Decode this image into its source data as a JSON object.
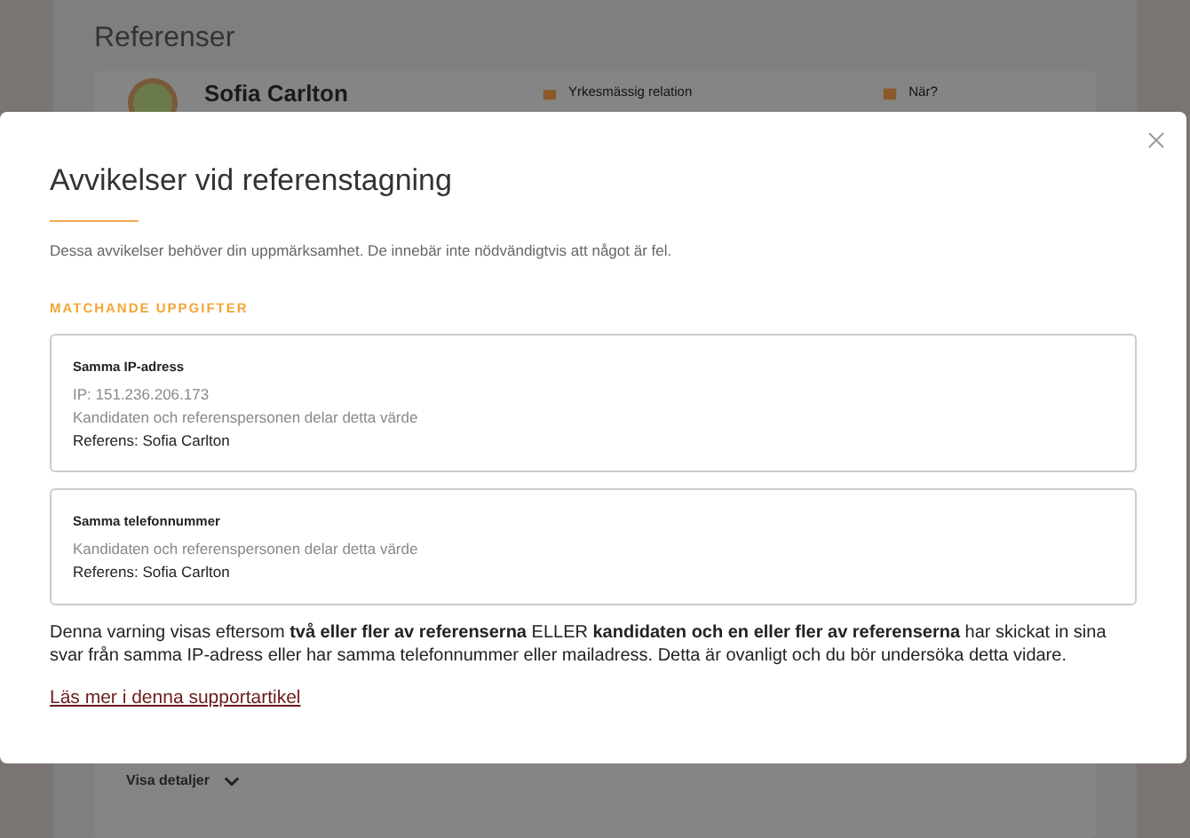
{
  "page": {
    "title": "Referenser",
    "reference": {
      "name": "Sofia Carlton",
      "relation_label": "Yrkesmässig relation",
      "when_label": "När?",
      "details_toggle": "Visa detaljer"
    }
  },
  "modal": {
    "title": "Avvikelser vid referenstagning",
    "description": "Dessa avvikelser behöver din uppmärksamhet. De innebär inte nödvändigtvis att något är fel.",
    "section_heading": "MATCHANDE UPPGIFTER",
    "matches": [
      {
        "title": "Samma IP-adress",
        "value": "IP: 151.236.206.173",
        "note": "Kandidaten och referenspersonen delar detta värde",
        "reference": "Referens: Sofia Carlton"
      },
      {
        "title": "Samma telefonnummer",
        "note": "Kandidaten och referenspersonen delar detta värde",
        "reference": "Referens: Sofia Carlton"
      }
    ],
    "explanation": "Denna varning visas eftersom **två eller fler av referenserna** ELLER **kandidaten och en eller fler av referenserna** har skickat in sina svar från samma IP-adress eller har samma telefonnummer eller mailadress. Detta är ovanligt och du bör undersöka detta vidare.",
    "link": "Läs mer i denna supportartikel"
  }
}
